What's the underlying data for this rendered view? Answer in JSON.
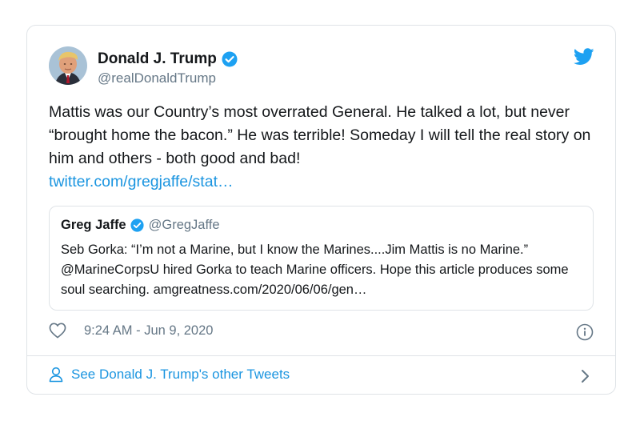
{
  "tweet": {
    "author_name": "Donald J. Trump",
    "author_handle": "@realDonaldTrump",
    "text": "Mattis was our Country’s most overrated General. He talked a lot, but never “brought home the bacon.” He was terrible! Someday I will tell the real story on him and others - both good and bad!",
    "link": "twitter.com/gregjaffe/stat…",
    "timestamp": "9:24 AM - Jun 9, 2020"
  },
  "quote": {
    "author_name": "Greg Jaffe",
    "author_handle": "@GregJaffe",
    "text": "Seb Gorka: “I’m not a Marine, but I know the Marines....Jim Mattis is no Marine.” @MarineCorpsU hired Gorka to teach Marine officers. Hope this article produces some soul searching. amgreatness.com/2020/06/06/gen…"
  },
  "footer": {
    "link_label": "See Donald J. Trump's other Tweets"
  },
  "icons": {
    "verified": "verified-badge-icon",
    "bird": "twitter-bird-icon",
    "heart": "heart-icon",
    "info": "info-icon",
    "user": "user-icon",
    "chevron": "chevron-right-icon"
  },
  "colors": {
    "accent": "#1da1f2",
    "link": "#1b95e0",
    "muted": "#657786",
    "border": "#dfe3e7"
  }
}
